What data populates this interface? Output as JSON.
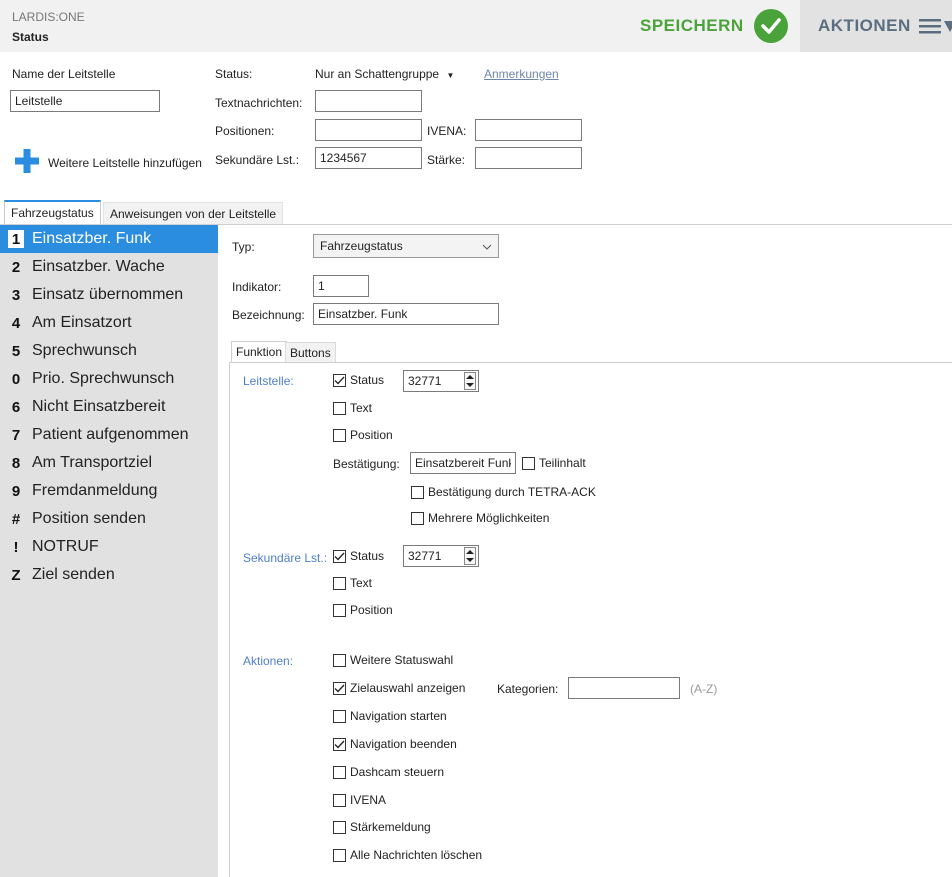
{
  "header": {
    "app_name": "LARDIS:ONE",
    "page_title": "Status",
    "save_label": "SPEICHERN",
    "actions_label": "AKTIONEN",
    "save_icon": "check-circle-icon",
    "actions_icon": "menu-dropdown-icon",
    "accent_green": "#4aa33a"
  },
  "form": {
    "name_label": "Name der Leitstelle",
    "name_value": "Leitstelle",
    "status_label": "Status:",
    "status_value": "Nur an Schattengruppe",
    "notes_link": "Anmerkungen",
    "textmsg_label": "Textnachrichten:",
    "textmsg_value": "",
    "positions_label": "Positionen:",
    "positions_value": "",
    "ivena_label": "IVENA:",
    "ivena_value": "",
    "secondary_label": "Sekundäre Lst.:",
    "secondary_value": "1234567",
    "strength_label": "Stärke:",
    "strength_value": "",
    "add_label": "Weitere Leitstelle hinzufügen",
    "add_icon": "plus-icon"
  },
  "tabs": [
    {
      "label": "Fahrzeugstatus",
      "active": true
    },
    {
      "label": "Anweisungen von der Leitstelle",
      "active": false
    }
  ],
  "statuses": [
    {
      "key": "1",
      "name": "Einsatzber. Funk",
      "active": true
    },
    {
      "key": "2",
      "name": "Einsatzber. Wache"
    },
    {
      "key": "3",
      "name": "Einsatz übernommen"
    },
    {
      "key": "4",
      "name": "Am Einsatzort"
    },
    {
      "key": "5",
      "name": "Sprechwunsch"
    },
    {
      "key": "0",
      "name": "Prio. Sprechwunsch"
    },
    {
      "key": "6",
      "name": "Nicht Einsatzbereit"
    },
    {
      "key": "7",
      "name": "Patient aufgenommen"
    },
    {
      "key": "8",
      "name": "Am Transportziel"
    },
    {
      "key": "9",
      "name": "Fremdanmeldung"
    },
    {
      "key": "#",
      "name": "Position senden"
    },
    {
      "key": "!",
      "name": "NOTRUF"
    },
    {
      "key": "Z",
      "name": "Ziel senden"
    }
  ],
  "detail": {
    "type_label": "Typ:",
    "type_value": "Fahrzeugstatus",
    "indicator_label": "Indikator:",
    "indicator_value": "1",
    "designation_label": "Bezeichnung:",
    "designation_value": "Einsatzber. Funk",
    "subtabs": [
      {
        "label": "Funktion",
        "active": true
      },
      {
        "label": "Buttons",
        "active": false
      }
    ],
    "leitstelle": {
      "label": "Leitstelle:",
      "status_label": "Status",
      "status_checked": true,
      "status_value": "32771",
      "text_label": "Text",
      "text_checked": false,
      "position_label": "Position",
      "position_checked": false,
      "confirm_label": "Bestätigung:",
      "confirm_value": "Einsatzbereit Funk",
      "partial_label": "Teilinhalt",
      "partial_checked": false,
      "tetra_label": "Bestätigung durch TETRA-ACK",
      "tetra_checked": false,
      "multi_label": "Mehrere Möglichkeiten",
      "multi_checked": false
    },
    "secondary": {
      "label": "Sekundäre Lst.:",
      "status_label": "Status",
      "status_checked": true,
      "status_value": "32771",
      "text_label": "Text",
      "text_checked": false,
      "position_label": "Position",
      "position_checked": false
    },
    "actions": {
      "label": "Aktionen:",
      "items": [
        {
          "label": "Weitere Statuswahl",
          "checked": false
        },
        {
          "label": "Zielauswahl anzeigen",
          "checked": true
        },
        {
          "label": "Navigation starten",
          "checked": false
        },
        {
          "label": "Navigation beenden",
          "checked": true
        },
        {
          "label": "Dashcam steuern",
          "checked": false
        },
        {
          "label": "IVENA",
          "checked": false
        },
        {
          "label": "Stärkemeldung",
          "checked": false
        },
        {
          "label": "Alle Nachrichten löschen",
          "checked": false
        }
      ],
      "categories_label": "Kategorien:",
      "categories_value": "",
      "categories_hint": "(A-Z)"
    }
  }
}
